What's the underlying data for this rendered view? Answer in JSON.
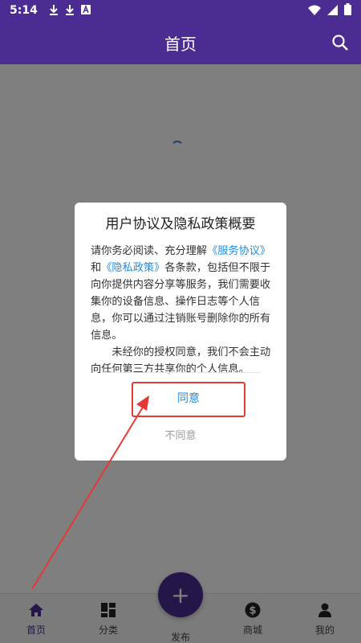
{
  "status_bar": {
    "time": "5:14",
    "left_icons": [
      "download-icon",
      "download-icon",
      "a-icon"
    ],
    "right_icons": [
      "wifi-icon",
      "signal-icon",
      "battery-icon"
    ]
  },
  "app_bar": {
    "title": "首页",
    "search_icon": "search-icon",
    "background": "#4b2c93"
  },
  "dialog": {
    "title": "用户协议及隐私政策概要",
    "para1_before": "请你务必阅读、充分理解",
    "link_service": "《服务协议》",
    "para1_middle": "和",
    "link_privacy": "《隐私政策》",
    "para1_after": "各条款，包括但不限于向你提供内容分享等服务，我们需要收集你的设备信息、操作日志等个人信息，你可以通过注销账号删除你的所有信息。",
    "para2": "未经你的授权同意，我们不会主动向任何第三方共享你的个人信息。",
    "agree_label": "同意",
    "disagree_label": "不同意",
    "link_color": "#1f8ce0"
  },
  "bottom_nav": {
    "items": [
      {
        "label": "首页",
        "icon": "home-icon",
        "active": true
      },
      {
        "label": "分类",
        "icon": "grid-icon",
        "active": false
      },
      {
        "label": "发布",
        "icon": "plus-icon",
        "active": false
      },
      {
        "label": "商城",
        "icon": "dollar-icon",
        "active": false
      },
      {
        "label": "我的",
        "icon": "person-icon",
        "active": false
      }
    ],
    "fab_symbol": "+"
  },
  "annotation": {
    "highlight_color": "#e53935"
  }
}
